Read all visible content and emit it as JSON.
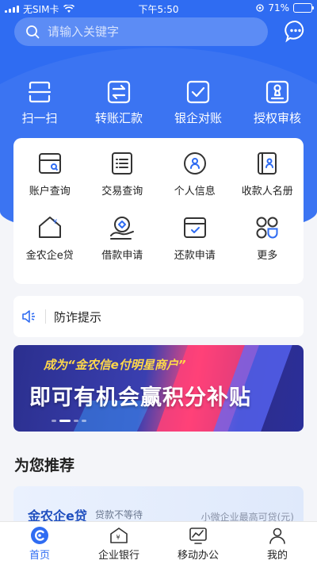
{
  "status_bar": {
    "carrier": "无SIM卡",
    "time": "下午5:50",
    "battery_percent": "71%",
    "battery_level": 0.71
  },
  "search": {
    "placeholder": "请输入关键字"
  },
  "quick_actions": [
    {
      "label": "扫一扫",
      "icon": "scan-icon"
    },
    {
      "label": "转账汇款",
      "icon": "transfer-icon"
    },
    {
      "label": "银企对账",
      "icon": "reconcile-icon"
    },
    {
      "label": "授权审核",
      "icon": "authorize-icon"
    }
  ],
  "services": [
    {
      "label": "账户查询",
      "icon": "account-query-icon"
    },
    {
      "label": "交易查询",
      "icon": "transaction-query-icon"
    },
    {
      "label": "个人信息",
      "icon": "personal-info-icon"
    },
    {
      "label": "收款人名册",
      "icon": "payee-list-icon"
    },
    {
      "label": "金农企e贷",
      "icon": "loan-house-icon"
    },
    {
      "label": "借款申请",
      "icon": "borrow-icon"
    },
    {
      "label": "还款申请",
      "icon": "repay-icon"
    },
    {
      "label": "更多",
      "icon": "more-icon"
    }
  ],
  "notice": {
    "label": "防诈提示"
  },
  "banner": {
    "subtitle": "成为“金农信e付明星商户”",
    "title": "即可有机会赢积分补贴"
  },
  "recommend": {
    "title": "为您推荐",
    "card_name": "金农企e贷",
    "card_tag": "贷款不等待",
    "card_note": "小微企业最高可贷(元)"
  },
  "tabbar": [
    {
      "label": "首页",
      "icon": "home-icon",
      "active": true
    },
    {
      "label": "企业银行",
      "icon": "enterprise-bank-icon",
      "active": false
    },
    {
      "label": "移动办公",
      "icon": "mobile-office-icon",
      "active": false
    },
    {
      "label": "我的",
      "icon": "profile-icon",
      "active": false
    }
  ],
  "colors": {
    "brand_blue": "#2f6cf2",
    "banner_yellow": "#ffd84a"
  }
}
